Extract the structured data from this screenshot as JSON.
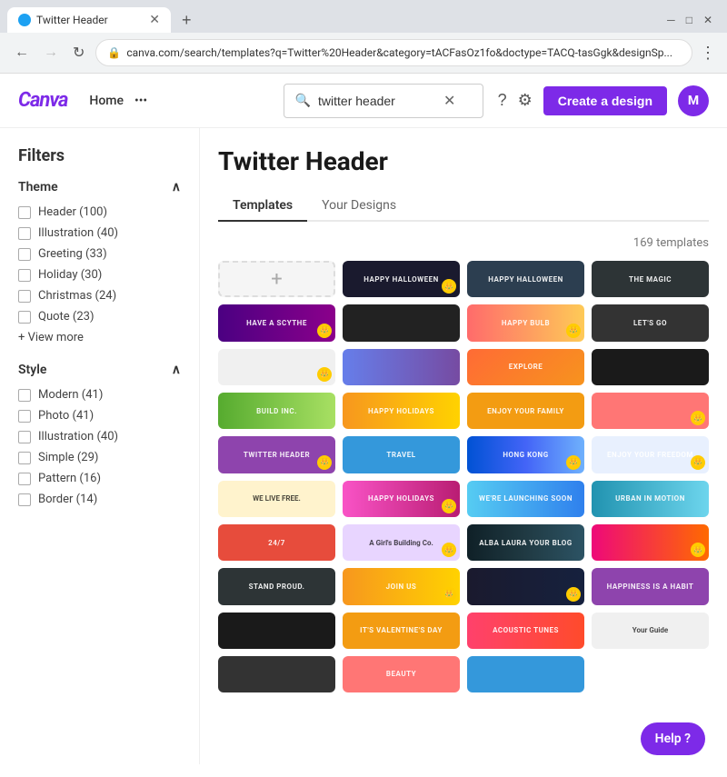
{
  "browser": {
    "tab_title": "Twitter Header",
    "url": "canva.com/search/templates?q=Twitter%20Header&category=tACFasOz1fo&doctype=TACQ-tasGgk&designSp...",
    "favicon_color": "#1da1f2"
  },
  "header": {
    "logo": "Canva",
    "nav_home": "Home",
    "nav_more": "•••",
    "search_value": "twitter header",
    "search_placeholder": "Search",
    "help_label": "?",
    "create_label": "Create a design",
    "avatar_label": "M"
  },
  "page": {
    "title": "Twitter Header",
    "tabs": [
      "Templates",
      "Your Designs"
    ],
    "active_tab": "Templates",
    "templates_count": "169 templates"
  },
  "filters": {
    "title": "Filters",
    "theme_section": "Theme",
    "theme_items": [
      {
        "label": "Header (100)"
      },
      {
        "label": "Illustration (40)"
      },
      {
        "label": "Greeting (33)"
      },
      {
        "label": "Holiday (30)"
      },
      {
        "label": "Christmas (24)"
      },
      {
        "label": "Quote (23)"
      }
    ],
    "view_more": "+ View more",
    "style_section": "Style",
    "style_items": [
      {
        "label": "Modern (41)"
      },
      {
        "label": "Photo (41)"
      },
      {
        "label": "Illustration (40)"
      },
      {
        "label": "Simple (29)"
      },
      {
        "label": "Pattern (16)"
      },
      {
        "label": "Border (14)"
      }
    ]
  },
  "help_float": "Help ?",
  "templates": [
    {
      "id": 1,
      "cls": "t2",
      "text": "HAPPY HALLOWEEN",
      "crown": true
    },
    {
      "id": 2,
      "cls": "t3",
      "text": "Happy Halloween",
      "crown": false
    },
    {
      "id": 3,
      "cls": "t20",
      "text": "The Magic",
      "crown": false
    },
    {
      "id": 4,
      "cls": "t4",
      "text": "Have a SCYTHE",
      "crown": true
    },
    {
      "id": 5,
      "cls": "t5",
      "text": "",
      "crown": false
    },
    {
      "id": 6,
      "cls": "t6",
      "text": "happy bulb",
      "crown": true
    },
    {
      "id": 7,
      "cls": "t9",
      "text": "LET'S GO",
      "crown": false
    },
    {
      "id": 8,
      "cls": "t7",
      "text": "",
      "crown": true
    },
    {
      "id": 9,
      "cls": "t8",
      "text": "",
      "crown": false
    },
    {
      "id": 10,
      "cls": "t1",
      "text": "explore",
      "crown": false
    },
    {
      "id": 11,
      "cls": "t11",
      "text": "",
      "crown": false
    },
    {
      "id": 12,
      "cls": "t12",
      "text": "BUILD INC.",
      "crown": false
    },
    {
      "id": 13,
      "cls": "t10",
      "text": "HAPPY HOLIDAYS",
      "crown": false
    },
    {
      "id": 14,
      "cls": "t24",
      "text": "ENJOY YOUR FAMILY",
      "crown": false
    },
    {
      "id": 15,
      "cls": "t32",
      "text": "",
      "crown": true
    },
    {
      "id": 16,
      "cls": "t22",
      "text": "TWITTER HEADER",
      "crown": true
    },
    {
      "id": 17,
      "cls": "t27",
      "text": "Travel",
      "crown": false
    },
    {
      "id": 18,
      "cls": "t14",
      "text": "HONG KONG",
      "crown": true
    },
    {
      "id": 19,
      "cls": "t13",
      "text": "ENJOY YOUR FREEDOM",
      "crown": true
    },
    {
      "id": 20,
      "cls": "t16",
      "text": "WE LIVE FREE.",
      "crown": false
    },
    {
      "id": 21,
      "cls": "t15",
      "text": "HAPPY HOLIDAYS",
      "crown": true
    },
    {
      "id": 22,
      "cls": "t29",
      "text": "WE'RE LAUNCHING SOON",
      "crown": false
    },
    {
      "id": 23,
      "cls": "t17",
      "text": "URBAN IN MOTION",
      "crown": false
    },
    {
      "id": 24,
      "cls": "t18",
      "text": "24/7",
      "crown": false
    },
    {
      "id": 25,
      "cls": "t30",
      "text": "A Girl's Building Co.",
      "crown": true
    },
    {
      "id": 26,
      "cls": "t31",
      "text": "alba laura your blog",
      "crown": false
    },
    {
      "id": 27,
      "cls": "t19",
      "text": "",
      "crown": true
    },
    {
      "id": 28,
      "cls": "t20",
      "text": "Stand proud.",
      "crown": false
    },
    {
      "id": 29,
      "cls": "t21",
      "text": "join us",
      "crown": true
    },
    {
      "id": 30,
      "cls": "t25",
      "text": "",
      "crown": true
    },
    {
      "id": 31,
      "cls": "t22",
      "text": "HAPPINESS IS A HABIT",
      "crown": false
    },
    {
      "id": 32,
      "cls": "t11",
      "text": "",
      "crown": false
    },
    {
      "id": 33,
      "cls": "t24",
      "text": "It's Valentine's Day",
      "crown": false
    },
    {
      "id": 34,
      "cls": "t26",
      "text": "Acoustic Tunes",
      "crown": false
    },
    {
      "id": 35,
      "cls": "t7",
      "text": "Your Guide",
      "crown": false
    },
    {
      "id": 36,
      "cls": "t9",
      "text": "",
      "crown": false
    },
    {
      "id": 37,
      "cls": "t32",
      "text": "BEAUTY",
      "crown": false
    },
    {
      "id": 38,
      "cls": "t27",
      "text": "",
      "crown": false
    }
  ]
}
